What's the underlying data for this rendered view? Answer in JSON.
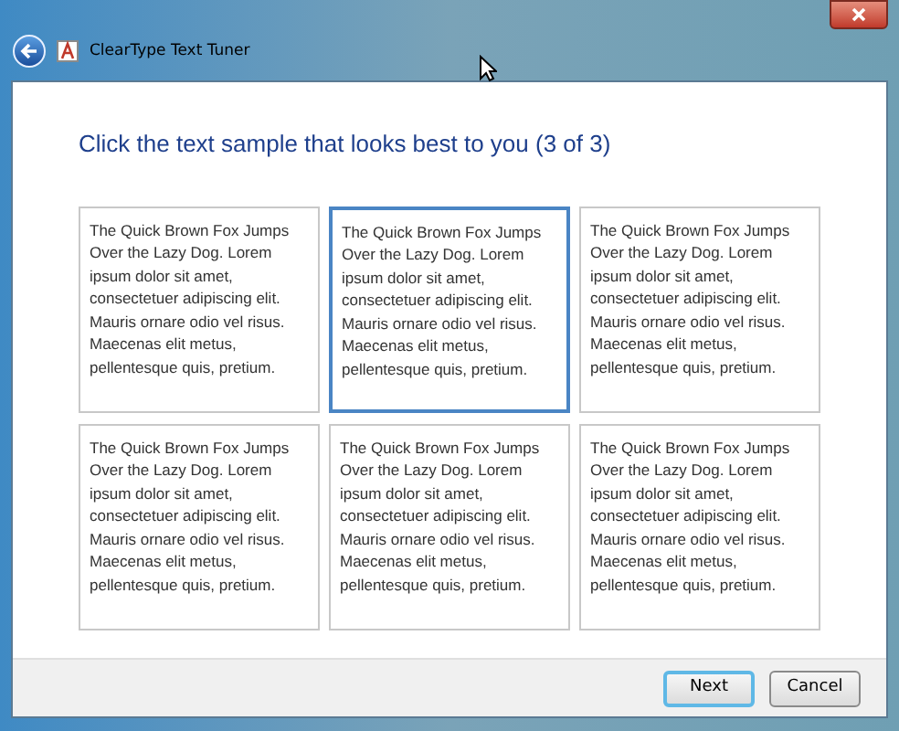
{
  "window": {
    "title": "ClearType Text Tuner"
  },
  "heading": "Click the text sample that looks best to you (3 of 3)",
  "samples": [
    {
      "text": "The Quick Brown Fox Jumps\nOver the Lazy Dog. Lorem\nipsum dolor sit amet,\nconsectetuer adipiscing elit.\nMauris ornare odio vel risus.\nMaecenas elit metus,\npellentesque quis, pretium.",
      "selected": false
    },
    {
      "text": "The Quick Brown Fox Jumps\nOver the Lazy Dog. Lorem\nipsum dolor sit amet,\nconsectetuer adipiscing elit.\nMauris ornare odio vel risus.\nMaecenas elit metus,\npellentesque quis, pretium.",
      "selected": true
    },
    {
      "text": "The Quick Brown Fox Jumps\nOver the Lazy Dog. Lorem\nipsum dolor sit amet,\nconsectetuer adipiscing elit.\nMauris ornare odio vel risus.\nMaecenas elit metus,\npellentesque quis, pretium.",
      "selected": false
    },
    {
      "text": "The Quick Brown Fox Jumps\nOver the Lazy Dog. Lorem\nipsum dolor sit amet,\nconsectetuer adipiscing elit.\nMauris ornare odio vel risus.\nMaecenas elit metus,\npellentesque quis, pretium.",
      "selected": false
    },
    {
      "text": "The Quick Brown Fox Jumps\nOver the Lazy Dog. Lorem\nipsum dolor sit amet,\nconsectetuer adipiscing elit.\nMauris ornare odio vel risus.\nMaecenas elit metus,\npellentesque quis, pretium.",
      "selected": false
    },
    {
      "text": "The Quick Brown Fox Jumps\nOver the Lazy Dog. Lorem\nipsum dolor sit amet,\nconsectetuer adipiscing elit.\nMauris ornare odio vel risus.\nMaecenas elit metus,\npellentesque quis, pretium.",
      "selected": false
    }
  ],
  "buttons": [
    {
      "label": "Next",
      "default": true
    },
    {
      "label": "Cancel",
      "default": false
    }
  ]
}
